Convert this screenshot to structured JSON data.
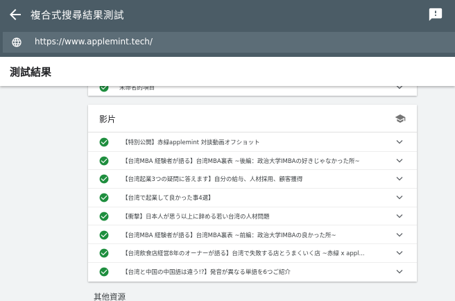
{
  "appbar": {
    "title": "複合式搜尋結果測試",
    "back_icon": "arrow-back-icon",
    "feedback_icon": "feedback-icon"
  },
  "urlbar": {
    "globe_icon": "globe-icon",
    "url": "https://www.applemint.tech/"
  },
  "header": {
    "title": "測試結果"
  },
  "prev_card": {
    "item_label": "未命名的項目"
  },
  "video_card": {
    "title": "影片",
    "title_icon": "school-icon",
    "items": [
      {
        "label": "【特別公開】赤緑applemint 対談動画オフショット"
      },
      {
        "label": "【台湾MBA 経験者が語る】台湾MBA裏表 ~後編：政治大学IMBAの好きじゃなかった所~"
      },
      {
        "label": "【台湾起業3つの疑問に答えます】自分の給与、人材採用、顧客獲得"
      },
      {
        "label": "【台湾で起業して良かった事4選】"
      },
      {
        "label": "【衝撃】日本人が思う以上に辞める若い台湾の人材問題"
      },
      {
        "label": "【台湾MBA 経験者が語る】台湾MBA裏表 ~前編：政治大学IMBAの良かった所~"
      },
      {
        "label": "【台湾飲食店経営8年のオーナーが語る】台湾で失敗する店とうまくいく店 ~赤緑 x appl..."
      },
      {
        "label": "【台湾と中国の中国語は違う!?】発音が異なる単語を6つご紹介"
      }
    ]
  },
  "other_resources": {
    "label": "其他資源"
  },
  "colors": {
    "appbar": "#4b5c66",
    "url_field": "#5c6d77",
    "check_green": "#1e8e3e",
    "background": "#f1f3f4"
  }
}
